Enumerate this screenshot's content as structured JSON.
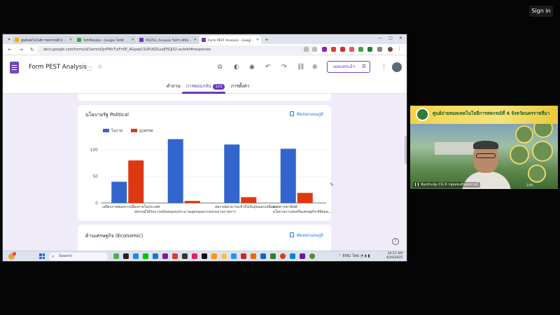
{
  "meeting": {
    "sign_in": "Sign in"
  },
  "browser": {
    "tabs": [
      {
        "label": "ศูนย์เทคโนโลยีการสหกรณ์ที่ 6 จังหวัดนครราชสีมา",
        "favicon_color": "#f4b400"
      },
      {
        "label": "ไดรฟ์ของฉัน - Google ไดรฟ์",
        "favicon_color": "#34a853"
      },
      {
        "label": "PESTEL Analysis วิเคราะห์ปัจจัยภายนอก",
        "favicon_color": "#673ab7"
      },
      {
        "label": "Form PEST Analysis - Google ฟอร์ม",
        "favicon_color": "#673ab7"
      }
    ],
    "new_tab": "+",
    "url": "docs.google.com/forms/d/1emmQjnPWcTvjFn5E_AGpepCSUPU0ZLuejPSQJ32-ac/edit#responses"
  },
  "forms": {
    "title": "Form PEST Analysis",
    "publish_label": "เผยแพร่แล้ว",
    "tabs": [
      {
        "label": "คำถาม"
      },
      {
        "label": "การตอบกลับ",
        "badge": "121"
      },
      {
        "label": "การตั้งค่า"
      }
    ]
  },
  "cards": {
    "political": {
      "title": "นโยบายรัฐ Political",
      "copy_label": "คัดลอกแผนภูมิ"
    },
    "economic": {
      "title": "ด้านเศรษฐกิจ (Economic)",
      "copy_label": "คัดลอกแผนภูมิ"
    }
  },
  "chart_data": {
    "type": "bar",
    "title": "",
    "xlabel": "",
    "ylabel": "",
    "ylim": [
      0,
      125
    ],
    "yticks": [
      0,
      50,
      100
    ],
    "grid": true,
    "legend": "top-left",
    "category_labels_line1": [
      "เสถียรภาพของการเมืองภายในประเทศ",
      "สหกรณ์สามารถเข้าถึงเงินทุนนอกเหนือจาก",
      "ธนาคารพาณิชย์"
    ],
    "category_labels_line2": [
      "สหกรณ์ได้รับการสนับสนุนงบประมาณอุดหนุนจากหน่วยงานราชการ",
      "นโยบายการส่งเสริมเศรษฐกิจ ดิจิตอล..."
    ],
    "categories": [
      "เสถียรภาพของการเมืองภายในประเทศ",
      "สหกรณ์ได้รับการสนับสนุนงบประมาณอุดหนุนจากหน่วยงานราชการ",
      "สหกรณ์สามารถเข้าถึงเงินทุนนอกเหนือจากธนาคารพาณิชย์",
      "นโยบายการส่งเสริมเศรษฐกิจ ดิจิตอล..."
    ],
    "series": [
      {
        "name": "โอกาส",
        "color": "#3366cc",
        "values": [
          40,
          120,
          110,
          102
        ]
      },
      {
        "name": "อุปสรรค",
        "color": "#dc3912",
        "values": [
          80,
          4,
          11,
          19
        ]
      }
    ]
  },
  "taskbar": {
    "weather_badge": "1",
    "search_placeholder": "Search",
    "tray_text": "ENG ไทย",
    "time": "10:11 AM",
    "date": "4/29/2025"
  },
  "webcam": {
    "banner_title": "ศูนย์ถ่ายทอดเทคโนโลยีการสหกรณ์ที่ 6 จังหวัดนครราชสีมา",
    "participant_name": "ห้องประชุม CG 6 กลุ่มส่งเสริมสหกรณ์",
    "time_overlay": "3:09"
  }
}
